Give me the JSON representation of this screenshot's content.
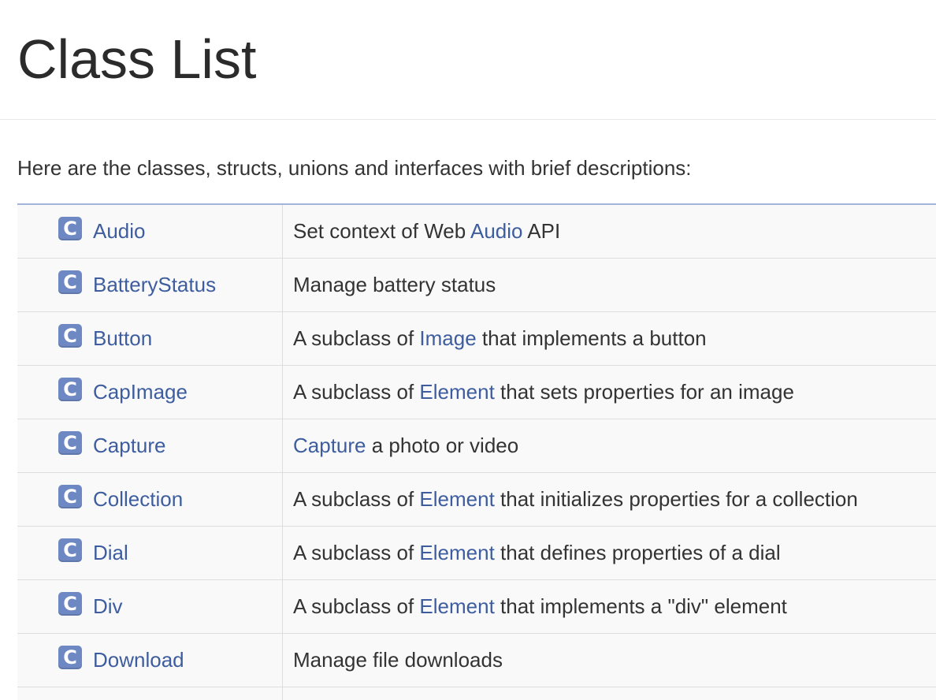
{
  "page": {
    "title": "Class List",
    "intro": "Here are the classes, structs, unions and interfaces with brief descriptions:"
  },
  "icons": {
    "class_icon_letter": "C",
    "class_icon_name": "class-icon",
    "icon_color": "#6e88c4",
    "link_color": "#3d5d9f"
  },
  "rows": [
    {
      "name": "Audio",
      "desc_pre": "Set context of Web ",
      "desc_link": "Audio",
      "desc_post": " API"
    },
    {
      "name": "BatteryStatus",
      "desc_pre": "Manage battery status",
      "desc_link": "",
      "desc_post": ""
    },
    {
      "name": "Button",
      "desc_pre": "A subclass of ",
      "desc_link": "Image",
      "desc_post": " that implements a button"
    },
    {
      "name": "CapImage",
      "desc_pre": "A subclass of ",
      "desc_link": "Element",
      "desc_post": " that sets properties for an image"
    },
    {
      "name": "Capture",
      "desc_pre": "",
      "desc_link": "Capture",
      "desc_post": " a photo or video"
    },
    {
      "name": "Collection",
      "desc_pre": "A subclass of ",
      "desc_link": "Element",
      "desc_post": " that initializes properties for a collection"
    },
    {
      "name": "Dial",
      "desc_pre": "A subclass of ",
      "desc_link": "Element",
      "desc_post": " that defines properties of a dial"
    },
    {
      "name": "Div",
      "desc_pre": "A subclass of ",
      "desc_link": "Element",
      "desc_post": " that implements a \"div\" element"
    },
    {
      "name": "Download",
      "desc_pre": "Manage file downloads",
      "desc_link": "",
      "desc_post": ""
    }
  ]
}
